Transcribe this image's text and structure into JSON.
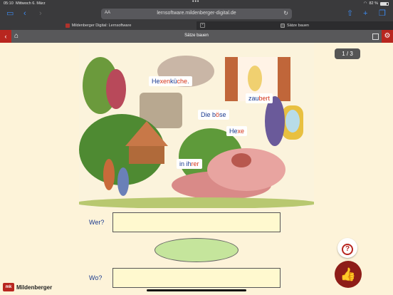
{
  "status": {
    "time": "05:10",
    "date": "Mittwoch 6. März",
    "battery": "82 %",
    "battery_level": 0.82
  },
  "browser": {
    "text_size_label": "AA",
    "url": "lernsoftware.mildenberger-digital.de",
    "tabs": [
      {
        "label": "Mildenberger Digital: Lernsoftware"
      },
      {
        "label": "Sätze bauen"
      }
    ]
  },
  "app": {
    "title": "Sätze bauen"
  },
  "exercise": {
    "page": "1 / 3",
    "words": [
      {
        "pre": "He",
        "hl": "xen",
        "mid": "kü",
        "hl2": "che",
        "post": "."
      },
      {
        "pre": "zau",
        "hl": "bert",
        "mid": "",
        "hl2": "",
        "post": ""
      },
      {
        "pre": "Die b",
        "hl": "ö",
        "mid": "se",
        "hl2": "",
        "post": ""
      },
      {
        "pre": "He",
        "hl": "xe",
        "mid": "",
        "hl2": "",
        "post": ""
      },
      {
        "pre": "in ih",
        "hl": "rer",
        "mid": "",
        "hl2": "",
        "post": ""
      }
    ],
    "wer_label": "Wer?",
    "wo_label": "Wo?"
  },
  "logo": {
    "mark": "mk",
    "name": "Mildenberger"
  },
  "colors": {
    "accent": "#b8261f",
    "toolbar": "#3a3a3c",
    "answer_box": "#fff9cf",
    "oval": "#c5e59c",
    "word_text": "#1a3a8f",
    "highlight": "#d4341a"
  }
}
